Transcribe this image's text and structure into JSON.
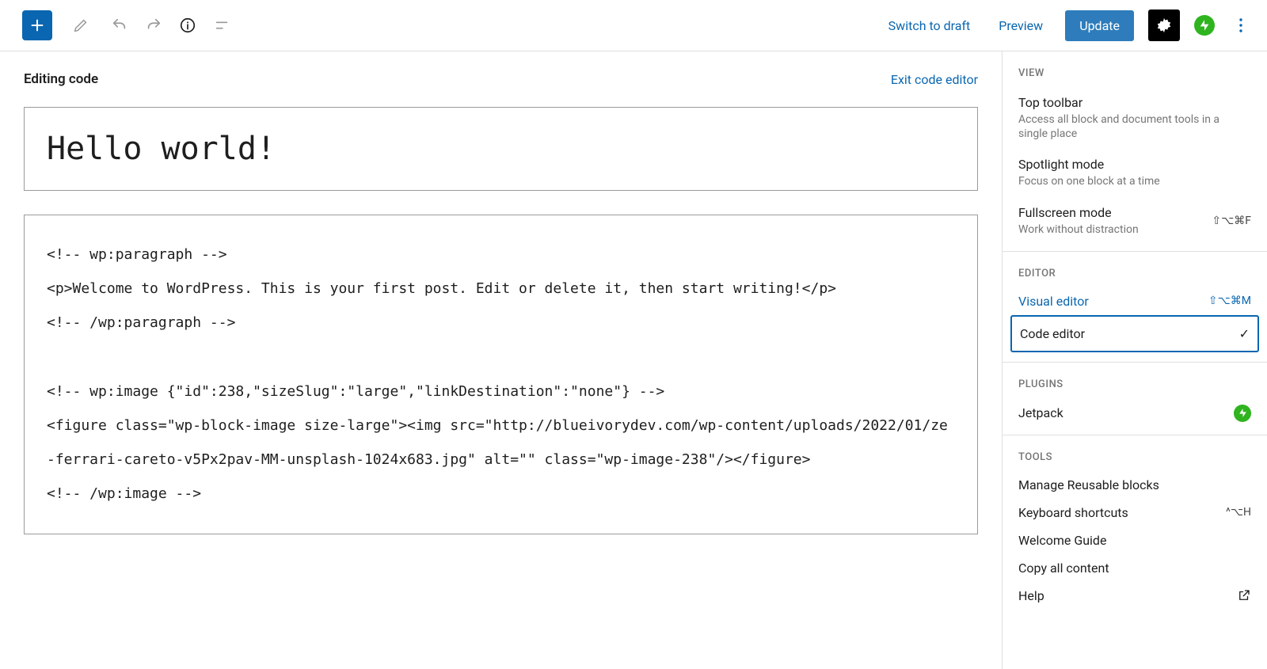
{
  "toolbar": {
    "switch_to_draft": "Switch to draft",
    "preview": "Preview",
    "update": "Update"
  },
  "main": {
    "header": {
      "title": "Editing code",
      "exit": "Exit code editor"
    },
    "post_title": "Hello world!",
    "post_content": "<!-- wp:paragraph -->\n<p>Welcome to WordPress. This is your first post. Edit or delete it, then start writing!</p>\n<!-- /wp:paragraph -->\n\n<!-- wp:image {\"id\":238,\"sizeSlug\":\"large\",\"linkDestination\":\"none\"} -->\n<figure class=\"wp-block-image size-large\"><img src=\"http://blueivorydev.com/wp-content/uploads/2022/01/ze-ferrari-careto-v5Px2pav-MM-unsplash-1024x683.jpg\" alt=\"\" class=\"wp-image-238\"/></figure>\n<!-- /wp:image -->"
  },
  "sidebar": {
    "sections": {
      "view": "VIEW",
      "editor": "EDITOR",
      "plugins": "PLUGINS",
      "tools": "TOOLS"
    },
    "view_items": [
      {
        "name": "Top toolbar",
        "desc": "Access all block and document tools in a single place",
        "shortcut": ""
      },
      {
        "name": "Spotlight mode",
        "desc": "Focus on one block at a time",
        "shortcut": ""
      },
      {
        "name": "Fullscreen mode",
        "desc": "Work without distraction",
        "shortcut": "⇧⌥⌘F"
      }
    ],
    "editor_items": [
      {
        "name": "Visual editor",
        "shortcut": "⇧⌥⌘M"
      },
      {
        "name": "Code editor",
        "shortcut": ""
      }
    ],
    "plugins_items": [
      {
        "name": "Jetpack"
      }
    ],
    "tools_items": [
      {
        "name": "Manage Reusable blocks",
        "shortcut": ""
      },
      {
        "name": "Keyboard shortcuts",
        "shortcut": "^⌥H"
      },
      {
        "name": "Welcome Guide",
        "shortcut": ""
      },
      {
        "name": "Copy all content",
        "shortcut": ""
      },
      {
        "name": "Help",
        "shortcut": ""
      }
    ]
  }
}
